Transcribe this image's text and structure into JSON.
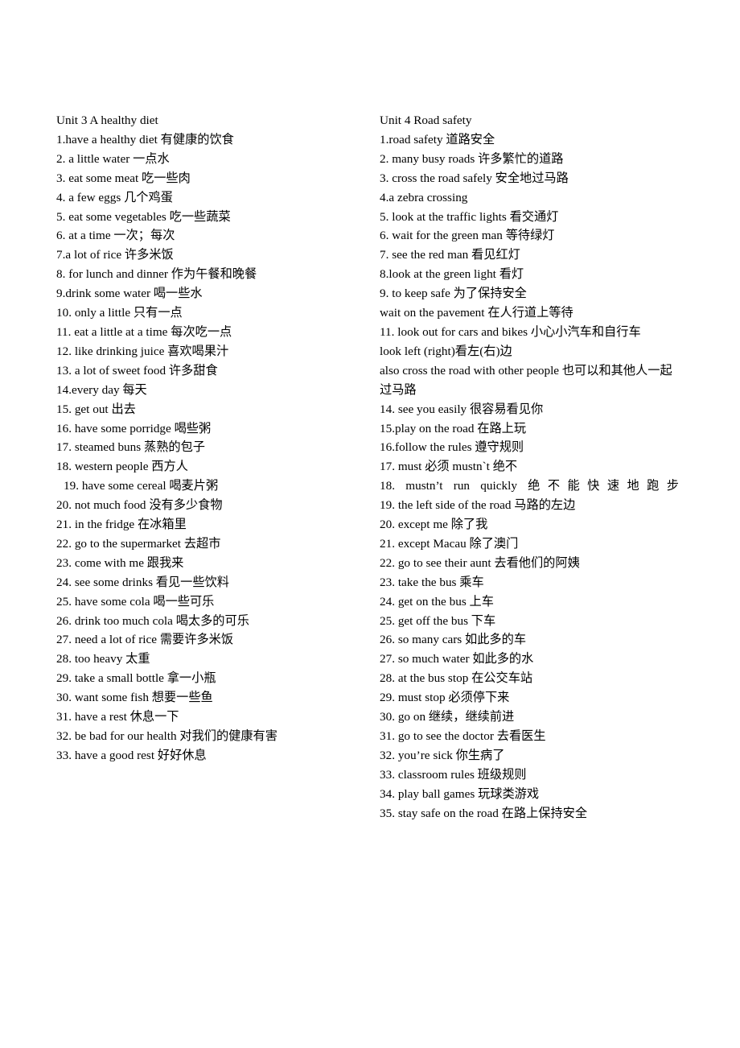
{
  "document": {
    "type": "vocabulary-list",
    "background_color": "#ffffff",
    "text_color": "#000000"
  },
  "columns": [
    {
      "id": "left",
      "title": "Unit 3 A healthy diet",
      "entries": [
        "1.have a healthy diet  有健康的饮食",
        "2. a little water    一点水",
        "3. eat some meat  吃一些肉",
        "4. a few eggs  几个鸡蛋",
        "5. eat some vegetables  吃一些蔬菜",
        "6. at a time  一次；每次",
        "7.a lot of rice  许多米饭",
        "8. for lunch and dinner 作为午餐和晚餐",
        "9.drink some water  喝一些水",
        "10. only a little  只有一点",
        "11. eat a little at a time  每次吃一点",
        "12. like drinking juice  喜欢喝果汁",
        "13. a lot of sweet food  许多甜食",
        "14.every day  每天",
        "15. get out  出去",
        "16. have some porridge  喝些粥",
        "17. steamed buns  蒸熟的包子",
        "18. western people  西方人",
        "19. have some cereal  喝麦片粥",
        "20. not much food  没有多少食物",
        "21. in the fridge  在冰箱里",
        "22. go to the supermarket 去超市",
        "23. come with me  跟我来",
        "24. see some drinks    看见一些饮料",
        "25. have some cola  喝一些可乐",
        "26. drink too much cola  喝太多的可乐",
        "27. need a lot of rice  需要许多米饭",
        "28. too heavy 太重",
        "29. take a small bottle 拿一小瓶",
        "30. want some fish  想要一些鱼",
        "31. have a rest  休息一下",
        "32. be bad for our health  对我们的健康有害",
        "33. have a good rest 好好休息"
      ]
    },
    {
      "id": "right",
      "title": "Unit 4 Road safety",
      "entries": [
        "1.road safety  道路安全",
        "2. many busy roads  许多繁忙的道路",
        "3. cross the road safely  安全地过马路",
        "4.a zebra crossing",
        "5. look at the traffic lights  看交通灯",
        "6. wait for the green man  等待绿灯",
        "7. see the red man  看见红灯",
        "8.look at the green light  看灯",
        "9. to keep safe  为了保持安全",
        "wait on the pavement  在人行道上等待",
        "11. look out for cars and bikes  小心小汽车和自行车",
        "look left (right)看左(右)边",
        "also cross the road with other people 也可以和其他人一起过马路",
        "14. see you easily 很容易看见你",
        "15.play on the road  在路上玩",
        "16.follow the rules  遵守规则",
        "17. must  必须 mustn`t 绝不",
        "18. mustn’t run quickly  绝不能快速地跑步",
        "19. the left side of the road  马路的左边",
        "20. except me  除了我",
        "21. except Macau 除了澳门",
        "22. go to see their aunt 去看他们的阿姨",
        "23. take the bus  乘车",
        "24. get on the bus  上车",
        "25. get off the bus  下车",
        "26. so many cars  如此多的车",
        "27. so much water  如此多的水",
        "28. at the bus stop 在公交车站",
        "29. must stop  必须停下来",
        "30. go on  继续，继续前进",
        "31. go to see the doctor 去看医生",
        "32. you’re sick  你生病了",
        "33. classroom rules  班级规则",
        "34. play ball games  玩球类游戏",
        "35. stay safe on the road  在路上保持安全"
      ]
    }
  ]
}
